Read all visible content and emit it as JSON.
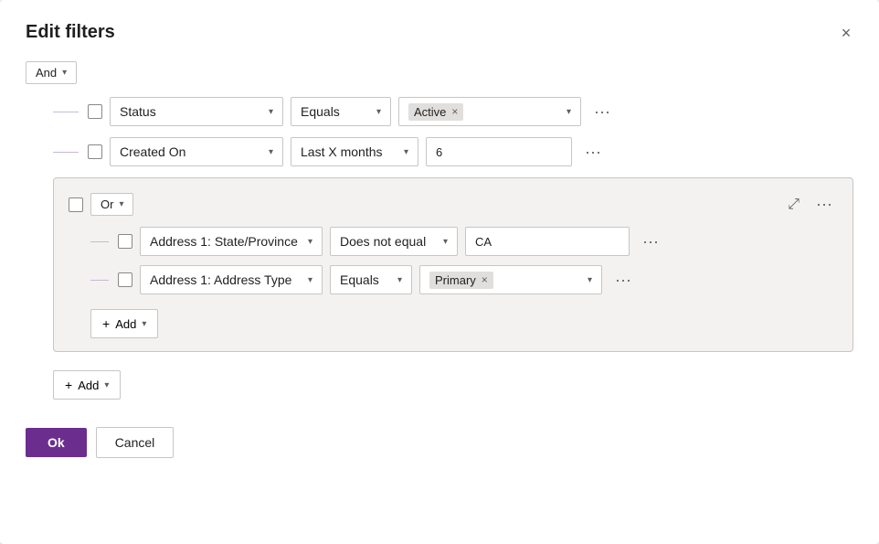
{
  "dialog": {
    "title": "Edit filters",
    "close_label": "×"
  },
  "and_group": {
    "label": "And",
    "chevron": "▾"
  },
  "filters": [
    {
      "id": "filter-status",
      "field": "Status",
      "operator": "Equals",
      "value_tag": "Active",
      "has_dropdown": true
    },
    {
      "id": "filter-created-on",
      "field": "Created On",
      "operator": "Last X months",
      "value_text": "6",
      "has_dropdown": false
    }
  ],
  "or_group": {
    "label": "Or",
    "chevron": "▾",
    "collapse_icon": "⤢",
    "more_icon": "···",
    "filters": [
      {
        "id": "or-filter-state",
        "field": "Address 1: State/Province",
        "operator": "Does not equal",
        "value_text": "CA",
        "has_dropdown": false
      },
      {
        "id": "or-filter-addr-type",
        "field": "Address 1: Address Type",
        "operator": "Equals",
        "value_tag": "Primary",
        "has_dropdown": true
      }
    ],
    "add_label": "Add",
    "add_chevron": "▾"
  },
  "add_label": "Add",
  "add_chevron": "▾",
  "footer": {
    "ok_label": "Ok",
    "cancel_label": "Cancel"
  }
}
